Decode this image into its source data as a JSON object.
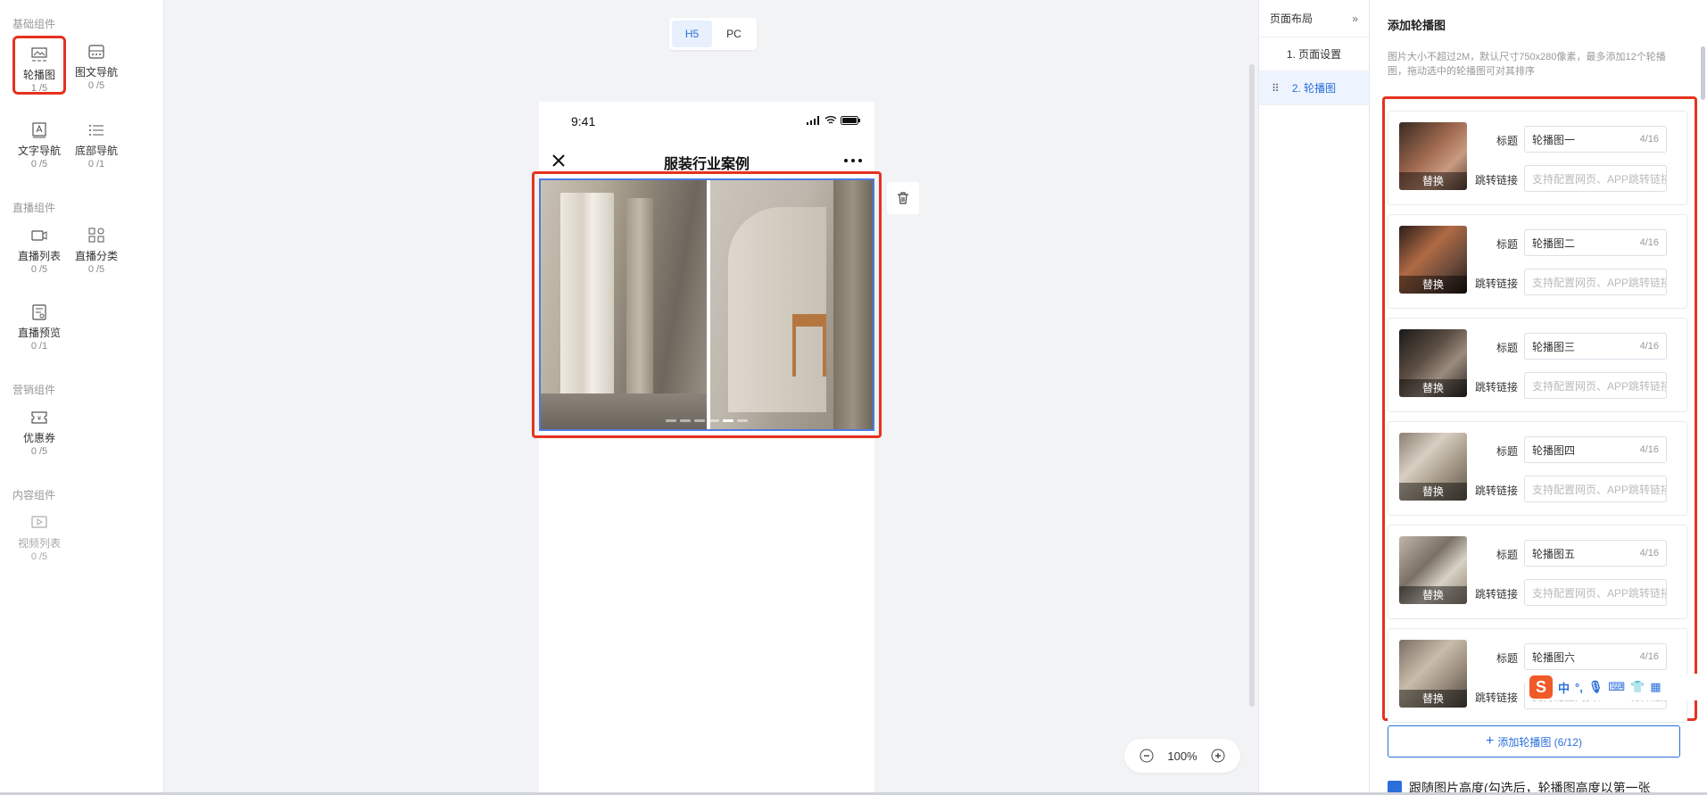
{
  "left_panel": {
    "groups": [
      {
        "title": "基础组件",
        "items": [
          {
            "name": "轮播图",
            "count": "1 /5",
            "icon": "carousel-icon",
            "selected": true
          },
          {
            "name": "图文导航",
            "count": "0 /5",
            "icon": "image-nav-icon"
          },
          {
            "name": "文字导航",
            "count": "0 /5",
            "icon": "text-nav-icon"
          },
          {
            "name": "底部导航",
            "count": "0 /1",
            "icon": "list-icon"
          }
        ]
      },
      {
        "title": "直播组件",
        "items": [
          {
            "name": "直播列表",
            "count": "0 /5",
            "icon": "live-list-icon"
          },
          {
            "name": "直播分类",
            "count": "0 /5",
            "icon": "category-icon"
          },
          {
            "name": "直播预览",
            "count": "0 /1",
            "icon": "preview-icon"
          }
        ]
      },
      {
        "title": "营销组件",
        "items": [
          {
            "name": "优惠券",
            "count": "0 /5",
            "icon": "coupon-icon"
          }
        ]
      },
      {
        "title": "内容组件",
        "items": [
          {
            "name": "视频列表",
            "count": "0 /5",
            "icon": "video-list-icon",
            "disabled": true
          }
        ]
      }
    ]
  },
  "canvas": {
    "mode_tabs": [
      "H5",
      "PC"
    ],
    "active_mode": "H5",
    "phone": {
      "time": "9:41",
      "title": "服装行业案例"
    },
    "zoom": "100%"
  },
  "layout_panel": {
    "title": "页面布局",
    "collapse": "»",
    "items": [
      "1. 页面设置",
      "2. 轮播图"
    ],
    "active_index": 1
  },
  "config": {
    "title": "添加轮播图",
    "description": "图片大小不超过2M，默认尺寸750x280像素，最多添加12个轮播图，拖动选中的轮播图可对其排序",
    "label_title": "标题",
    "label_link": "跳转链接",
    "replace": "替换",
    "link_placeholder": "支持配置网页、APP跳转链接",
    "cards": [
      {
        "title": "轮播图一",
        "count": "4/16"
      },
      {
        "title": "轮播图二",
        "count": "4/16"
      },
      {
        "title": "轮播图三",
        "count": "4/16"
      },
      {
        "title": "轮播图四",
        "count": "4/16"
      },
      {
        "title": "轮播图五",
        "count": "4/16"
      },
      {
        "title": "轮播图六",
        "count": "4/16"
      }
    ],
    "add_button": "添加轮播图 (6/12)",
    "checkbox_label": "跟随图片高度(勾选后，轮播图高度以第一张",
    "ime_label": "中"
  },
  "colors": {
    "accent": "#2a6fdb",
    "highlight": "#e5321f"
  }
}
